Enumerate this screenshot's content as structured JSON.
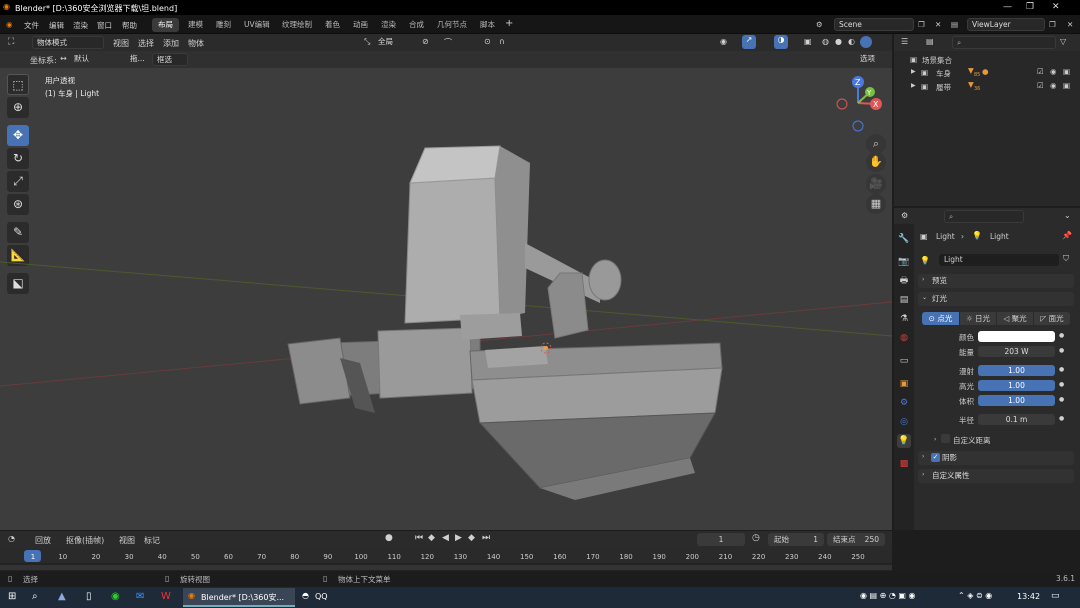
{
  "titlebar": {
    "title": "Blender* [D:\\360安全浏览器下载\\坦.blend]"
  },
  "menu": {
    "items": [
      "文件",
      "编辑",
      "渲染",
      "窗口",
      "帮助"
    ]
  },
  "workspaces": [
    "布局",
    "建模",
    "雕刻",
    "UV编辑",
    "纹理绘制",
    "着色",
    "动画",
    "渲染",
    "合成",
    "几何节点",
    "脚本"
  ],
  "scene": {
    "scene_label": "Scene",
    "viewlayer_label": "ViewLayer"
  },
  "viewport_header": {
    "mode": "物体模式",
    "menus": [
      "视图",
      "选择",
      "添加",
      "物体"
    ],
    "transform": "全局",
    "options": "选项"
  },
  "viewport_sub": {
    "coord_label": "坐标系:",
    "coord_value": "默认",
    "drag": "拖...",
    "select": "框选"
  },
  "viewport_info": {
    "view_name": "用户透视",
    "object": "(1) 车身 | Light"
  },
  "outliner": {
    "root": "场景集合",
    "items": [
      {
        "name": "车身",
        "badge": "85"
      },
      {
        "name": "履带",
        "badge": "36"
      }
    ]
  },
  "properties": {
    "breadcrumb_obj": "Light",
    "breadcrumb_data": "Light",
    "data_name": "Light",
    "preview": "预览",
    "light_section": "灯光",
    "light_types": [
      "点光",
      "日光",
      "聚光",
      "面光"
    ],
    "color_label": "颜色",
    "color": "#ffffff",
    "power_label": "能量",
    "power": "203 W",
    "diffuse_label": "漫射",
    "diffuse": "1.00",
    "specular_label": "高光",
    "specular": "1.00",
    "volume_label": "体积",
    "volume": "1.00",
    "radius_label": "半径",
    "radius": "0.1 m",
    "custom_distance": "自定义距离",
    "shadow": "阴影",
    "custom_props": "自定义属性"
  },
  "timeline": {
    "menus": [
      "回放",
      "抠像(插帧)",
      "视图",
      "标记"
    ],
    "current": "1",
    "start_label": "起始",
    "start": "1",
    "end_label": "结束点",
    "end": "250",
    "ticks": [
      "1",
      "10",
      "20",
      "30",
      "40",
      "50",
      "60",
      "70",
      "80",
      "90",
      "100",
      "110",
      "120",
      "130",
      "140",
      "150",
      "160",
      "170",
      "180",
      "190",
      "200",
      "210",
      "220",
      "230",
      "240",
      "250"
    ]
  },
  "statusbar": {
    "select": "选择",
    "rotate": "旋转视图",
    "context": "物体上下文菜单",
    "version": "3.6.1"
  },
  "taskbar": {
    "blender": "Blender* [D:\\360安...",
    "qq": "QQ",
    "time": "13:42"
  },
  "colors": {
    "accent": "#4772b3",
    "viewport_bg": "#3d3d3d"
  }
}
